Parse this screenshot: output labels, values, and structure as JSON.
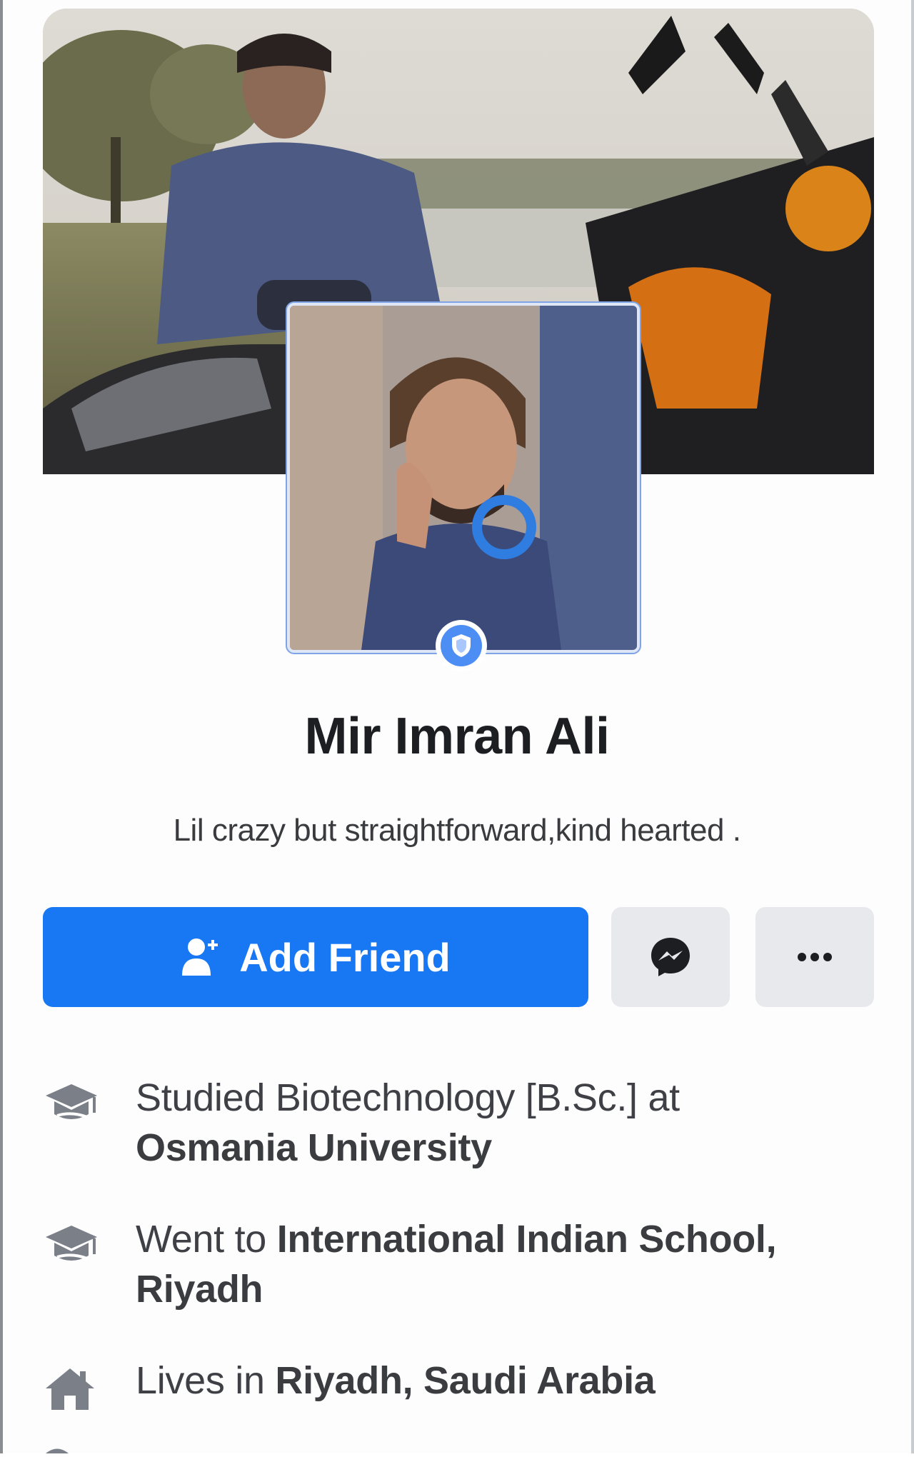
{
  "profile": {
    "name": "Mir Imran Ali",
    "bio": "Lil crazy but straightforward,kind hearted ."
  },
  "actions": {
    "add_friend_label": "Add Friend",
    "add_friend_icon": "add-person-icon",
    "messenger_icon": "messenger-icon",
    "more_icon": "more-dots-icon"
  },
  "intro": {
    "items": [
      {
        "icon": "graduation-cap-icon",
        "prefix": "Studied Biotechnology [B.Sc.] at",
        "strong": "Osmania University"
      },
      {
        "icon": "graduation-cap-icon",
        "prefix": "Went to",
        "strong": "International Indian School, Riyadh"
      },
      {
        "icon": "home-icon",
        "prefix": "Lives in",
        "strong": "Riyadh, Saudi Arabia"
      }
    ]
  },
  "colors": {
    "primary": "#1877f2",
    "button_gray": "#e8e9ec",
    "text_primary": "#1c1e21",
    "text_secondary": "#3e4045",
    "icon_gray": "#7a7f88"
  }
}
